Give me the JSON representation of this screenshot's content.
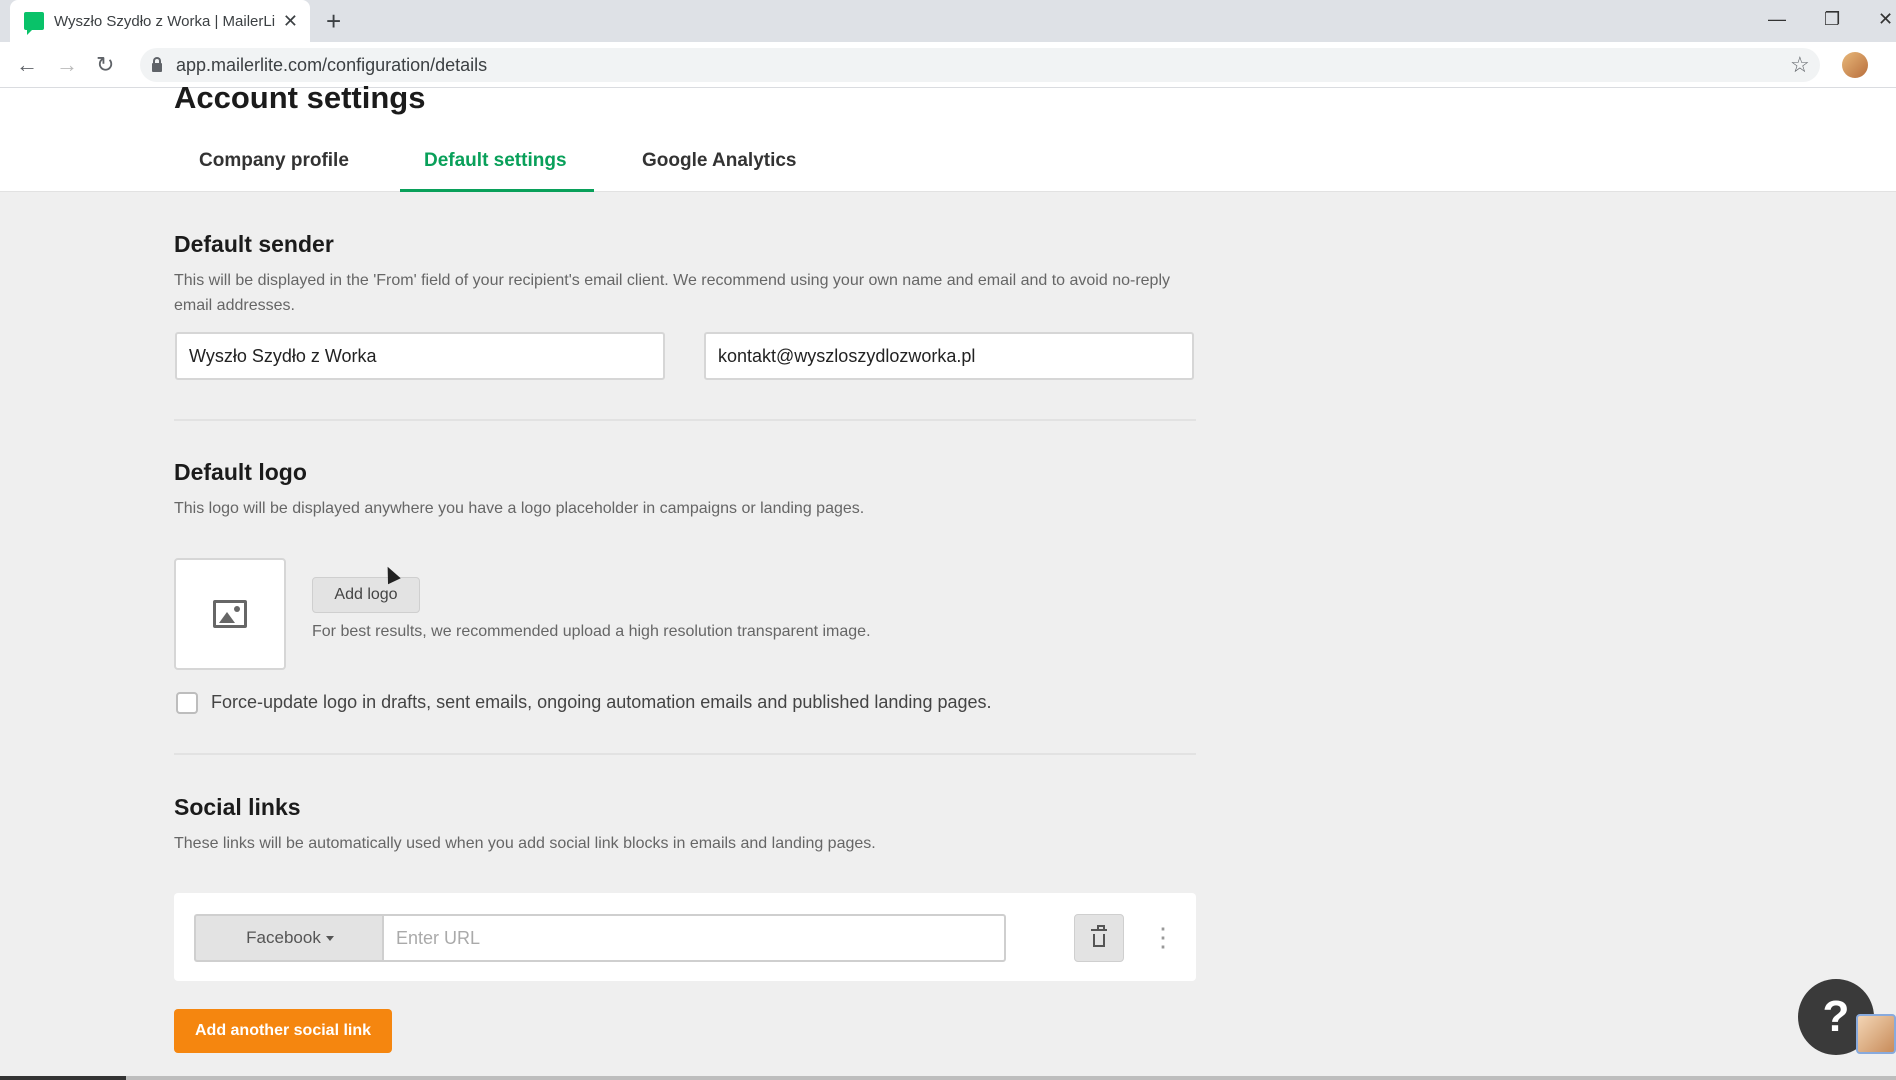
{
  "browser": {
    "tab_title": "Wyszło Szydło z Worka | MailerLite",
    "url": "app.mailerlite.com/configuration/details"
  },
  "page": {
    "title": "Account settings",
    "tabs": [
      {
        "label": "Company profile",
        "active": false
      },
      {
        "label": "Default settings",
        "active": true
      },
      {
        "label": "Google Analytics",
        "active": false
      }
    ]
  },
  "default_sender": {
    "title": "Default sender",
    "description": "This will be displayed in the 'From' field of your recipient's email client. We recommend using your own name and email and to avoid no-reply email addresses.",
    "name_value": "Wyszło Szydło z Worka",
    "email_value": "kontakt@wyszloszydlozworka.pl"
  },
  "default_logo": {
    "title": "Default logo",
    "description": "This logo will be displayed anywhere you have a logo placeholder in campaigns or landing pages.",
    "add_logo_label": "Add logo",
    "hint": "For best results, we recommended upload a high resolution transparent image.",
    "force_update_label": "Force-update logo in drafts, sent emails, ongoing automation emails and published landing pages.",
    "force_update_checked": false
  },
  "social_links": {
    "title": "Social links",
    "description": "These links will be automatically used when you add social link blocks in emails and landing pages.",
    "network_selected": "Facebook",
    "url_placeholder": "Enter URL",
    "add_another_label": "Add another social link"
  },
  "help": {
    "label": "?"
  },
  "colors": {
    "accent_green": "#09a05a",
    "add_button_orange": "#f5860f",
    "favicon_green": "#09c269"
  },
  "icons": [
    "favicon-icon",
    "close-icon",
    "plus-icon",
    "back-icon",
    "forward-icon",
    "reload-icon",
    "lock-icon",
    "star-icon",
    "image-placeholder-icon",
    "trash-icon",
    "more-vert-icon",
    "caret-down-icon",
    "help-icon"
  ]
}
